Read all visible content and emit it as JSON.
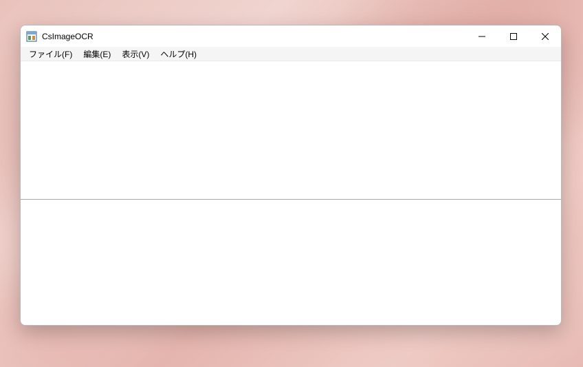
{
  "window": {
    "title": "CsImageOCR"
  },
  "menu": {
    "file": "ファイル(F)",
    "edit": "編集(E)",
    "view": "表示(V)",
    "help": "ヘルプ(H)"
  }
}
